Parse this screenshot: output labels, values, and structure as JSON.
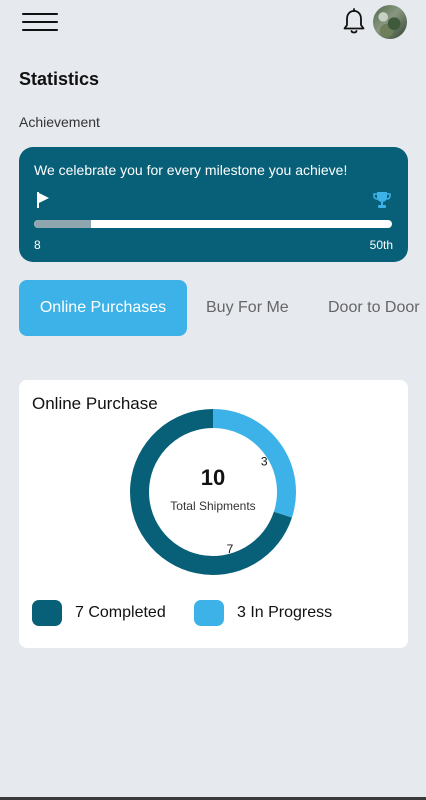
{
  "header": {
    "menu_icon": "hamburger-menu-icon",
    "notification_icon": "bell-icon",
    "avatar_icon": "user-avatar"
  },
  "page": {
    "title": "Statistics",
    "section_label": "Achievement"
  },
  "achievement": {
    "message": "We celebrate you for every milestone you achieve!",
    "start_icon": "flag-icon",
    "end_icon": "trophy-icon",
    "progress_fraction": 0.16,
    "start_label": "8",
    "end_label": "50th"
  },
  "tabs": [
    {
      "label": "Online Purchases",
      "active": true
    },
    {
      "label": "Buy For Me",
      "active": false
    },
    {
      "label": "Door to Door",
      "active": false
    }
  ],
  "purchase_panel": {
    "title": "Online Purchase",
    "total_value": "10",
    "total_label": "Total Shipments",
    "legend": [
      {
        "label": "7 Completed"
      },
      {
        "label": "3 In Progress"
      }
    ]
  },
  "colors": {
    "primary": "#075f78",
    "accent": "#3db2e8",
    "background": "#e6e9ee"
  },
  "chart_data": {
    "type": "pie",
    "title": "Online Purchase",
    "categories": [
      "Completed",
      "In Progress"
    ],
    "values": [
      7,
      3
    ],
    "colors": [
      "#075f78",
      "#3db2e8"
    ],
    "center_value": 10,
    "center_label": "Total Shipments",
    "data_labels": [
      "7",
      "3"
    ],
    "legend_placement": "bottom"
  }
}
